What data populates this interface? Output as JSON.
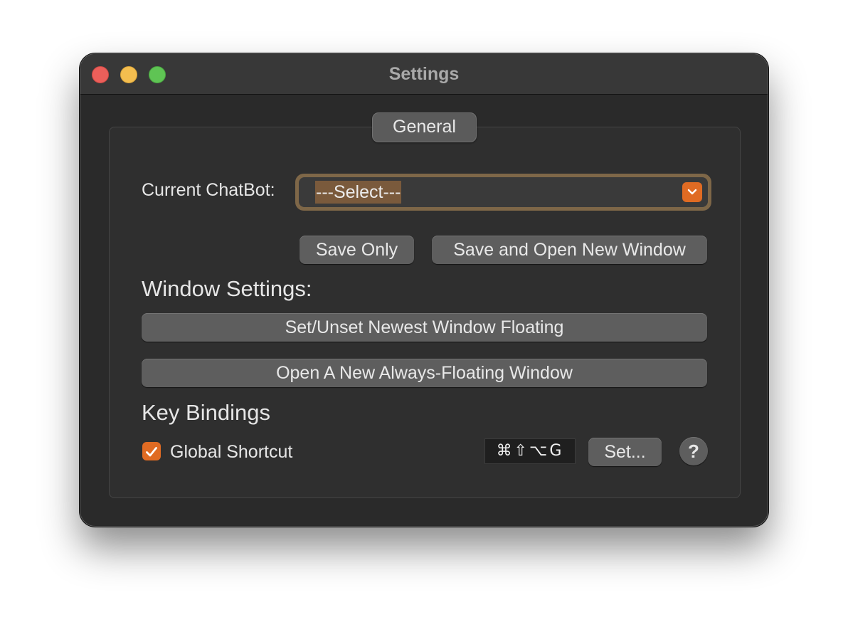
{
  "window": {
    "title": "Settings"
  },
  "tab": {
    "label": "General"
  },
  "chatbot": {
    "label": "Current ChatBot:",
    "selected": "---Select---",
    "dropdown_icon": "chevron-down-icon"
  },
  "actions": {
    "save_only": "Save Only",
    "save_and_open": "Save and Open New Window"
  },
  "window_settings": {
    "heading": "Window Settings:",
    "toggle_floating": "Set/Unset Newest Window Floating",
    "open_floating": "Open A New Always-Floating Window"
  },
  "key_bindings": {
    "heading": "Key Bindings",
    "global_shortcut_label": "Global Shortcut",
    "global_shortcut_checked": true,
    "shortcut_keys": "⌘⇧⌥G",
    "set_button": "Set...",
    "help_button": "?"
  },
  "colors": {
    "accent": "#e06b23",
    "close": "#ec5f5a",
    "minimize": "#f4be4f",
    "zoom": "#5fc454"
  }
}
